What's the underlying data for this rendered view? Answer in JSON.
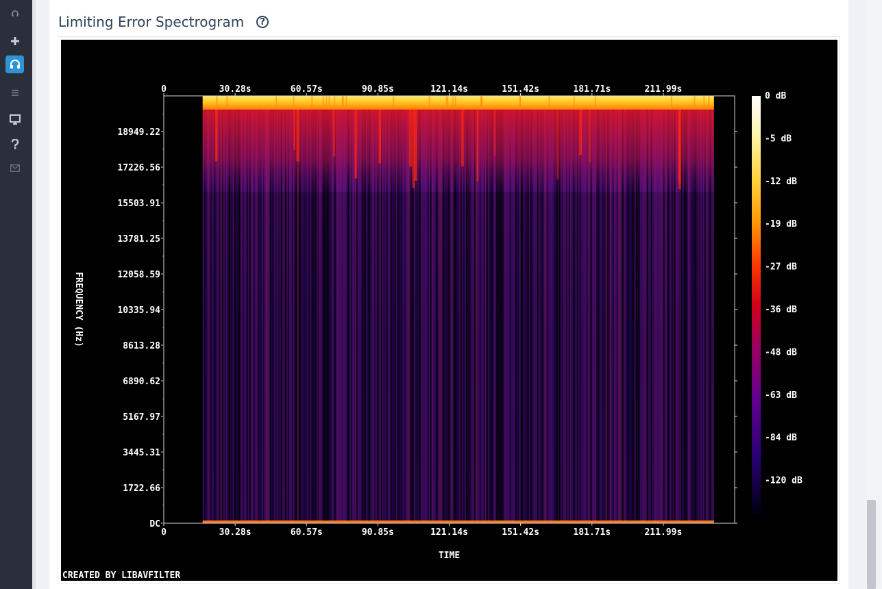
{
  "sidebar": {
    "items": [
      {
        "icon": "headphones-small-icon"
      },
      {
        "icon": "plus-icon"
      },
      {
        "icon": "headphones-icon",
        "active": true
      },
      {
        "icon": "list-icon"
      },
      {
        "icon": "monitor-icon"
      },
      {
        "icon": "question-icon"
      },
      {
        "icon": "mail-icon"
      }
    ]
  },
  "page": {
    "title": "Limiting Error Spectrogram",
    "help_glyph": "?"
  },
  "chart_data": {
    "type": "heatmap",
    "xlabel": "TIME",
    "ylabel": "FREQUENCY (Hz)",
    "x_ticks": [
      "0",
      "30.28s",
      "60.57s",
      "90.85s",
      "121.14s",
      "151.42s",
      "181.71s",
      "211.99s"
    ],
    "x_tick_values": [
      0,
      30.28,
      60.57,
      90.85,
      121.14,
      151.42,
      181.71,
      211.99
    ],
    "xlim": [
      0,
      242.27
    ],
    "y_ticks": [
      "DC",
      "1722.66",
      "3445.31",
      "5167.97",
      "6890.62",
      "8613.28",
      "10335.94",
      "12058.59",
      "13781.25",
      "15503.91",
      "17226.56",
      "18949.22"
    ],
    "y_tick_values": [
      0,
      1722.66,
      3445.31,
      5167.97,
      6890.62,
      8613.28,
      10335.94,
      12058.59,
      13781.25,
      15503.91,
      17226.56,
      18949.22
    ],
    "ylim": [
      0,
      20671.88
    ],
    "colorbar_labels": [
      "0 dB",
      "-5 dB",
      "-12 dB",
      "-19 dB",
      "-27 dB",
      "-36 dB",
      "-48 dB",
      "-63 dB",
      "-84 dB",
      "-120 dB"
    ],
    "colorbar_colors": [
      "#ffffff",
      "#fff3a8",
      "#ffd23c",
      "#ff9a08",
      "#ff3b00",
      "#d0001a",
      "#9a0060",
      "#62008e",
      "#2a0076",
      "#000010"
    ],
    "signal_start": 16.5,
    "signal_end": 233.5,
    "credit": "CREATED BY LIBAVFILTER"
  }
}
